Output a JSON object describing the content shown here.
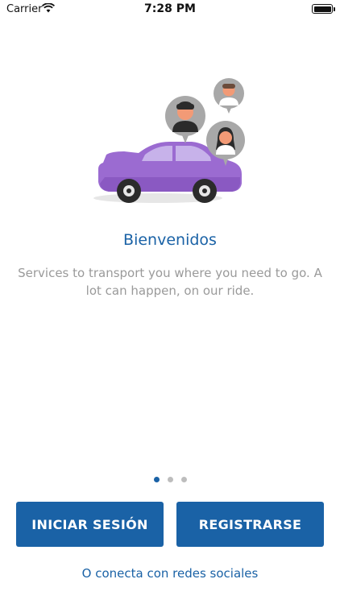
{
  "status_bar": {
    "carrier": "Carrier",
    "time": "7:28 PM",
    "wifi_icon": "wifi-icon",
    "battery_icon": "battery-icon"
  },
  "illustration": {
    "icon": "car-with-passengers-illustration",
    "colors": {
      "car": "#9b6bd1",
      "bubble": "#a8a8a8"
    }
  },
  "onboarding": {
    "title": "Bienvenidos",
    "description": "Services to transport you where you need to go. A lot can happen, on our ride.",
    "page_count": 3,
    "active_page": 1
  },
  "actions": {
    "login_label": "INICIAR SESIÓN",
    "register_label": "REGISTRARSE",
    "social_label": "O conecta con redes sociales"
  },
  "colors": {
    "accent": "#1a62a6",
    "text_muted": "#9a9a9a",
    "dot_inactive": "#bdbdbd"
  }
}
